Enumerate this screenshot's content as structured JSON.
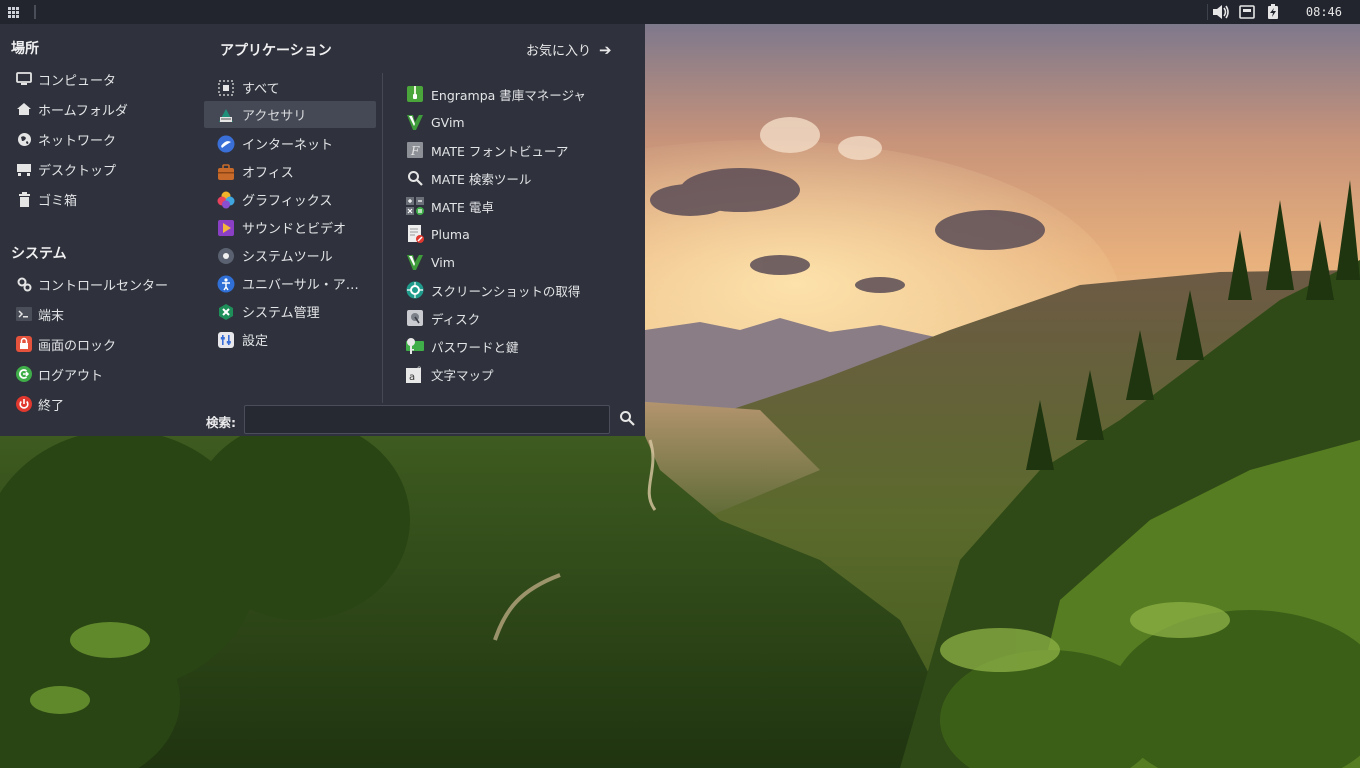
{
  "panel": {
    "clock": "08:46",
    "tray_icons": [
      "volume-icon",
      "network-wired-icon",
      "battery-charging-icon"
    ]
  },
  "menu": {
    "places": {
      "title": "場所",
      "items": [
        {
          "label": "コンピュータ",
          "icon": "computer-icon"
        },
        {
          "label": "ホームフォルダ",
          "icon": "home-icon"
        },
        {
          "label": "ネットワーク",
          "icon": "network-icon"
        },
        {
          "label": "デスクトップ",
          "icon": "desktop-icon"
        },
        {
          "label": "ゴミ箱",
          "icon": "trash-icon"
        }
      ]
    },
    "system": {
      "title": "システム",
      "items": [
        {
          "label": "コントロールセンター",
          "icon": "control-center-icon"
        },
        {
          "label": "端末",
          "icon": "terminal-icon"
        },
        {
          "label": "画面のロック",
          "icon": "lock-icon",
          "color": "#e5533d"
        },
        {
          "label": "ログアウト",
          "icon": "logout-icon",
          "color": "#3fae49"
        },
        {
          "label": "終了",
          "icon": "power-icon",
          "color": "#e0382f"
        }
      ]
    },
    "applications": {
      "title": "アプリケーション",
      "favorites_link": "お気に入り",
      "categories": [
        {
          "label": "すべて",
          "icon": "all-apps-icon"
        },
        {
          "label": "アクセサリ",
          "icon": "accessories-icon",
          "selected": true
        },
        {
          "label": "インターネット",
          "icon": "internet-icon"
        },
        {
          "label": "オフィス",
          "icon": "office-icon"
        },
        {
          "label": "グラフィックス",
          "icon": "graphics-icon"
        },
        {
          "label": "サウンドとビデオ",
          "icon": "sound-video-icon"
        },
        {
          "label": "システムツール",
          "icon": "system-tools-icon"
        },
        {
          "label": "ユニバーサル・ア…",
          "icon": "universal-access-icon"
        },
        {
          "label": "システム管理",
          "icon": "administration-icon"
        },
        {
          "label": "設定",
          "icon": "preferences-icon"
        }
      ],
      "apps": [
        {
          "label": "Engrampa 書庫マネージャ",
          "icon": "archive-manager-icon"
        },
        {
          "label": "GVim",
          "icon": "gvim-icon"
        },
        {
          "label": "MATE フォントビューア",
          "icon": "font-viewer-icon"
        },
        {
          "label": "MATE 検索ツール",
          "icon": "search-tool-icon"
        },
        {
          "label": "MATE 電卓",
          "icon": "calculator-icon"
        },
        {
          "label": "Pluma",
          "icon": "text-editor-icon"
        },
        {
          "label": "Vim",
          "icon": "vim-icon"
        },
        {
          "label": "スクリーンショットの取得",
          "icon": "screenshot-icon"
        },
        {
          "label": "ディスク",
          "icon": "disks-icon"
        },
        {
          "label": "パスワードと鍵",
          "icon": "passwords-keys-icon"
        },
        {
          "label": "文字マップ",
          "icon": "character-map-icon"
        }
      ]
    },
    "search": {
      "label": "検索:",
      "value": "",
      "placeholder": ""
    }
  }
}
